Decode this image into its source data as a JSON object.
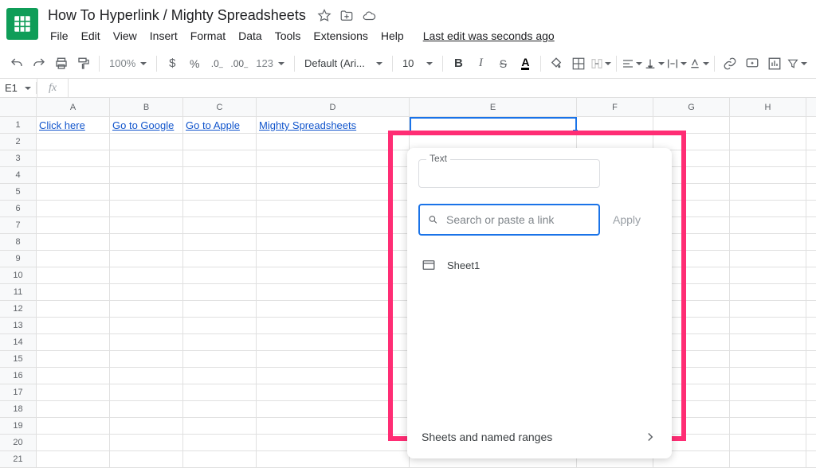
{
  "doc": {
    "title": "How To Hyperlink / Mighty Spreadsheets"
  },
  "menu": {
    "items": [
      "File",
      "Edit",
      "View",
      "Insert",
      "Format",
      "Data",
      "Tools",
      "Extensions",
      "Help"
    ],
    "last_edit": "Last edit was seconds ago"
  },
  "toolbar": {
    "zoom": "100%",
    "font": "Default (Ari...",
    "size": "10",
    "num_format": "123"
  },
  "fx": {
    "cell_ref": "E1"
  },
  "columns": [
    "A",
    "B",
    "C",
    "D",
    "E",
    "F",
    "G",
    "H"
  ],
  "rows": 21,
  "cells": {
    "a1": "Click here ",
    "b1": "Go to Google",
    "c1": "Go to Apple",
    "d1": "Mighty Spreadsheets"
  },
  "popup": {
    "text_label": "Text",
    "search_placeholder": "Search or paste a link",
    "apply": "Apply",
    "sheet_item": "Sheet1",
    "footer": "Sheets and named ranges"
  }
}
